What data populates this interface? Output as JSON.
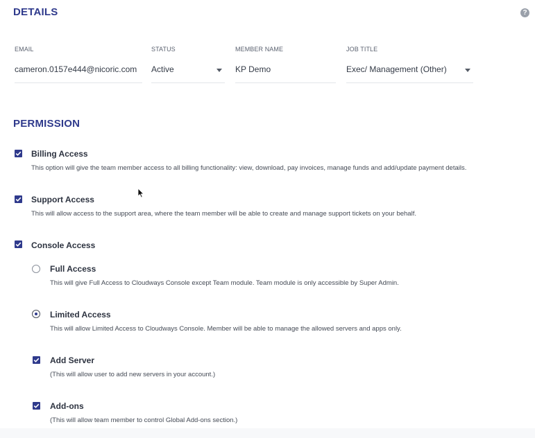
{
  "details": {
    "title": "DETAILS",
    "help_icon": "question-circle-icon",
    "fields": {
      "email": {
        "label": "EMAIL",
        "value": "cameron.0157e444@nicoric.com"
      },
      "status": {
        "label": "STATUS",
        "value": "Active"
      },
      "member_name": {
        "label": "MEMBER NAME",
        "value": "KP Demo"
      },
      "job_title": {
        "label": "JOB TITLE",
        "value": "Exec/ Management (Other)"
      }
    }
  },
  "permission": {
    "title": "PERMISSION",
    "billing": {
      "label": "Billing Access",
      "description": "This option will give the team member access to all billing functionality: view, download, pay invoices, manage funds and add/update payment details.",
      "checked": true
    },
    "support": {
      "label": "Support Access",
      "description": "This will allow access to the support area, where the team member will be able to create and manage support tickets on your behalf.",
      "checked": true
    },
    "console": {
      "label": "Console Access",
      "checked": true
    },
    "full": {
      "label": "Full Access",
      "description": "This will give Full Access to Cloudways Console except Team module. Team module is only accessible by Super Admin.",
      "selected": false
    },
    "limited": {
      "label": "Limited Access",
      "description": "This will allow Limited Access to Cloudways Console. Member will be able to manage the allowed servers and apps only.",
      "selected": true
    },
    "add_server": {
      "label": "Add Server",
      "description": "(This will allow user to add new servers in your account.)",
      "checked": true
    },
    "addons": {
      "label": "Add-ons",
      "description": "(This will allow team member to control Global Add-ons section.)",
      "checked": true
    }
  },
  "colors": {
    "accent": "#2f3a8c",
    "text": "#333a46",
    "divider": "#e3e5ea"
  }
}
